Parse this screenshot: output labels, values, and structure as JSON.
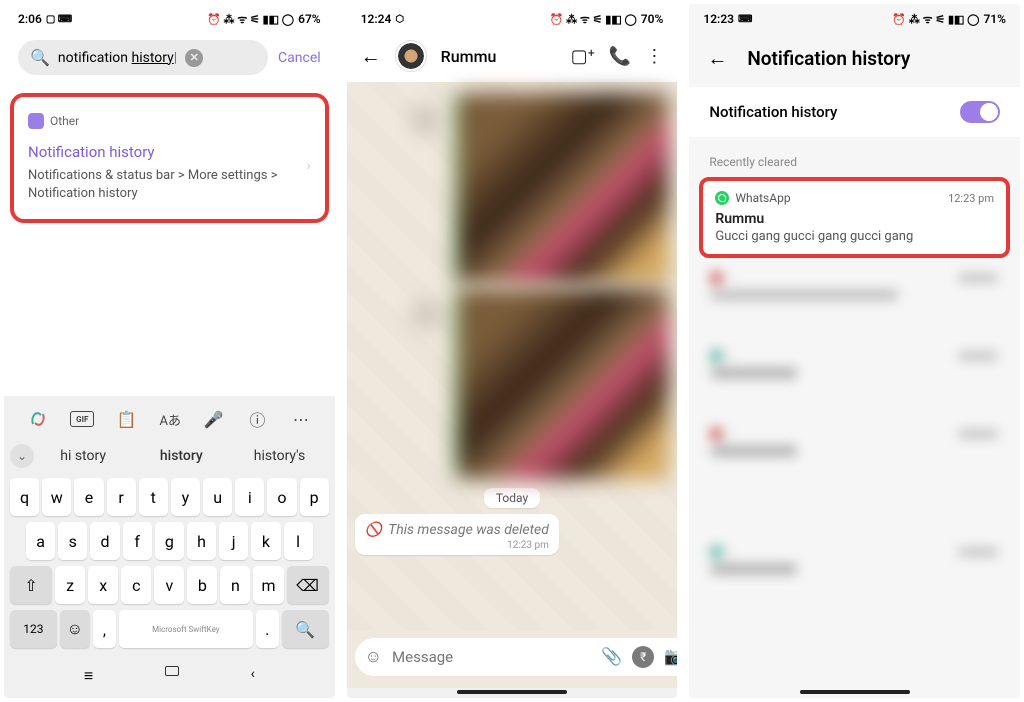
{
  "s1": {
    "status": {
      "time": "2:06",
      "battery": "67%",
      "icons": "⏰ ⁂ ᯤ ⚟ ▮◧ ◯"
    },
    "search": {
      "value": "notification ",
      "value2": "history",
      "cancel": "Cancel"
    },
    "result": {
      "tag": "Other",
      "title": "Notification history",
      "path": "Notifications & status bar > More settings > Notification history"
    },
    "kb": {
      "sugg1": "hi story",
      "sugg2": "history",
      "sugg3": "history's",
      "row1": [
        "q",
        "w",
        "e",
        "r",
        "t",
        "y",
        "u",
        "i",
        "o",
        "p"
      ],
      "row2": [
        "a",
        "s",
        "d",
        "f",
        "g",
        "h",
        "j",
        "k",
        "l"
      ],
      "row3": [
        "z",
        "x",
        "c",
        "v",
        "b",
        "n",
        "m"
      ],
      "shift": "⇧",
      "back": "⌫",
      "num": "123",
      "emoji": "☺",
      "search": "🔍",
      "space": "Microsoft SwiftKey"
    }
  },
  "s2": {
    "status": {
      "time": "12:24",
      "battery": "70%",
      "icons": "⏰ ⁂ ᯤ ⚟ ▮◧ ◯"
    },
    "contact": "Rummu",
    "date": "Today",
    "deleted": "This message was deleted",
    "deleted_time": "12:23 pm",
    "placeholder": "Message"
  },
  "s3": {
    "status": {
      "time": "12:23",
      "battery": "71%",
      "icons": "⏰ ⁂ ᯤ ⚟ ▮◧ ◯"
    },
    "title": "Notification history",
    "toggle_label": "Notification history",
    "section": "Recently cleared",
    "notif": {
      "app": "WhatsApp",
      "time": "12:23 pm",
      "sender": "Rummu",
      "body": "Gucci gang gucci gang gucci gang"
    }
  }
}
